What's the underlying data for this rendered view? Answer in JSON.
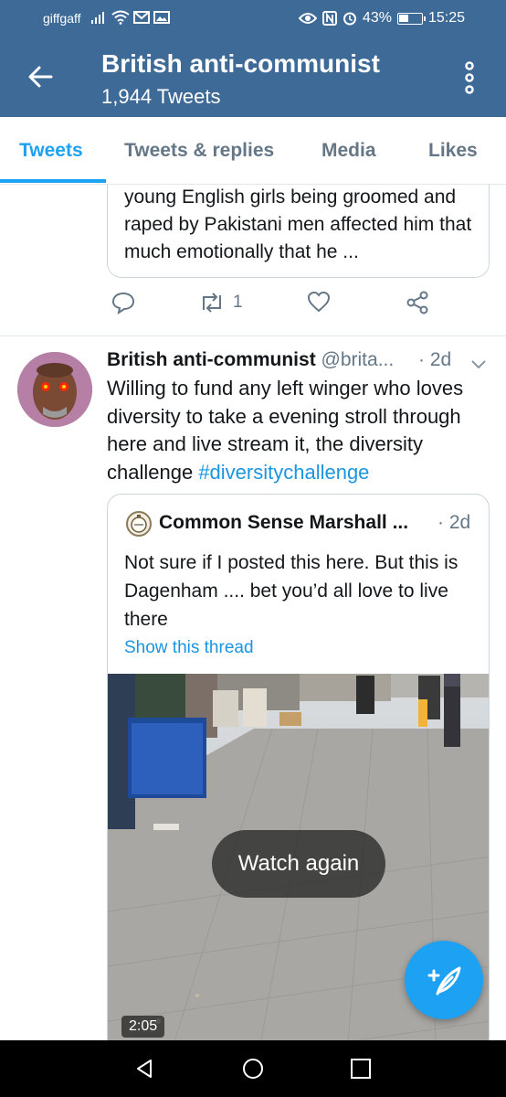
{
  "status_bar": {
    "carrier": "giffgaff",
    "battery": "43%",
    "time": "15:25",
    "icons": [
      "signal-icon",
      "wifi-icon",
      "mail-icon",
      "gallery-icon",
      "eye-icon",
      "nfc-icon",
      "alarm-icon",
      "battery-icon"
    ]
  },
  "header": {
    "title": "British anti-communist",
    "subtitle": "1,944 Tweets",
    "bg_color": "#3e6a97"
  },
  "tabs": [
    {
      "label": "Tweets",
      "active": true
    },
    {
      "label": "Tweets & replies",
      "active": false
    },
    {
      "label": "Media",
      "active": false
    },
    {
      "label": "Likes",
      "active": false
    }
  ],
  "previous_tweet": {
    "quote_text": "young English girls being groomed and raped by Pakistani men affected him that much emotionally that he ...",
    "retweet_count": "1"
  },
  "tweet": {
    "name": "British anti-communist",
    "handle": "@brita...",
    "time": "· 2d",
    "text": "Willing to fund any left winger who loves diversity to take a evening stroll through here and live stream it, the diversity challenge ",
    "hashtag": "#diversitychallenge",
    "quoted": {
      "name": "Common Sense Marshall ...",
      "time": "· 2d",
      "text": "Not sure if I posted this here. But this is Dagenham .... bet you’d all love to live there",
      "show_thread": "Show this thread",
      "video": {
        "overlay": "Watch again",
        "duration": "2:05"
      }
    }
  },
  "accent_color": "#1da1f2"
}
